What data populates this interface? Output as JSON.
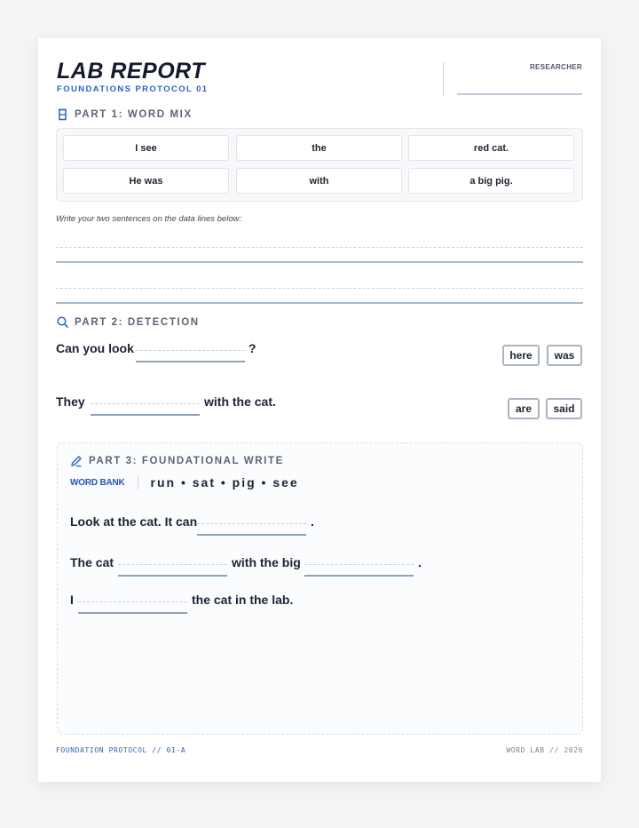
{
  "header": {
    "title": "LAB REPORT",
    "subtitle": "FOUNDATIONS PROTOCOL 01",
    "researcher_label": "RESEARCHER"
  },
  "part1": {
    "heading": "PART 1: WORD MIX",
    "tiles": [
      "I see",
      "the",
      "red cat.",
      "He was",
      "with",
      "a big pig."
    ],
    "instruction": "Write your two sentences on the data lines below:"
  },
  "part2": {
    "heading": "PART 2: DETECTION",
    "q1": {
      "before": "Can you look",
      "after": "?",
      "options": [
        "here",
        "was"
      ]
    },
    "q2": {
      "before": "They",
      "after": "with the cat.",
      "options": [
        "are",
        "said"
      ]
    }
  },
  "part3": {
    "heading": "PART 3: FOUNDATIONAL WRITE",
    "word_bank_label": "WORD BANK",
    "word_bank": "run • sat • pig • see",
    "s1": {
      "a": "Look at the cat. It can",
      "b": "."
    },
    "s2": {
      "a": "The cat",
      "b": "with the big",
      "c": "."
    },
    "s3": {
      "a": "I",
      "b": "the cat in the lab."
    }
  },
  "footer": {
    "left": "FOUNDATION PROTOCOL // 01-A",
    "right": "WORD LAB // 2026"
  },
  "colors": {
    "accent": "#2d62c8",
    "heading_gray": "#5b6575",
    "line_blue": "#a9b9cc"
  }
}
